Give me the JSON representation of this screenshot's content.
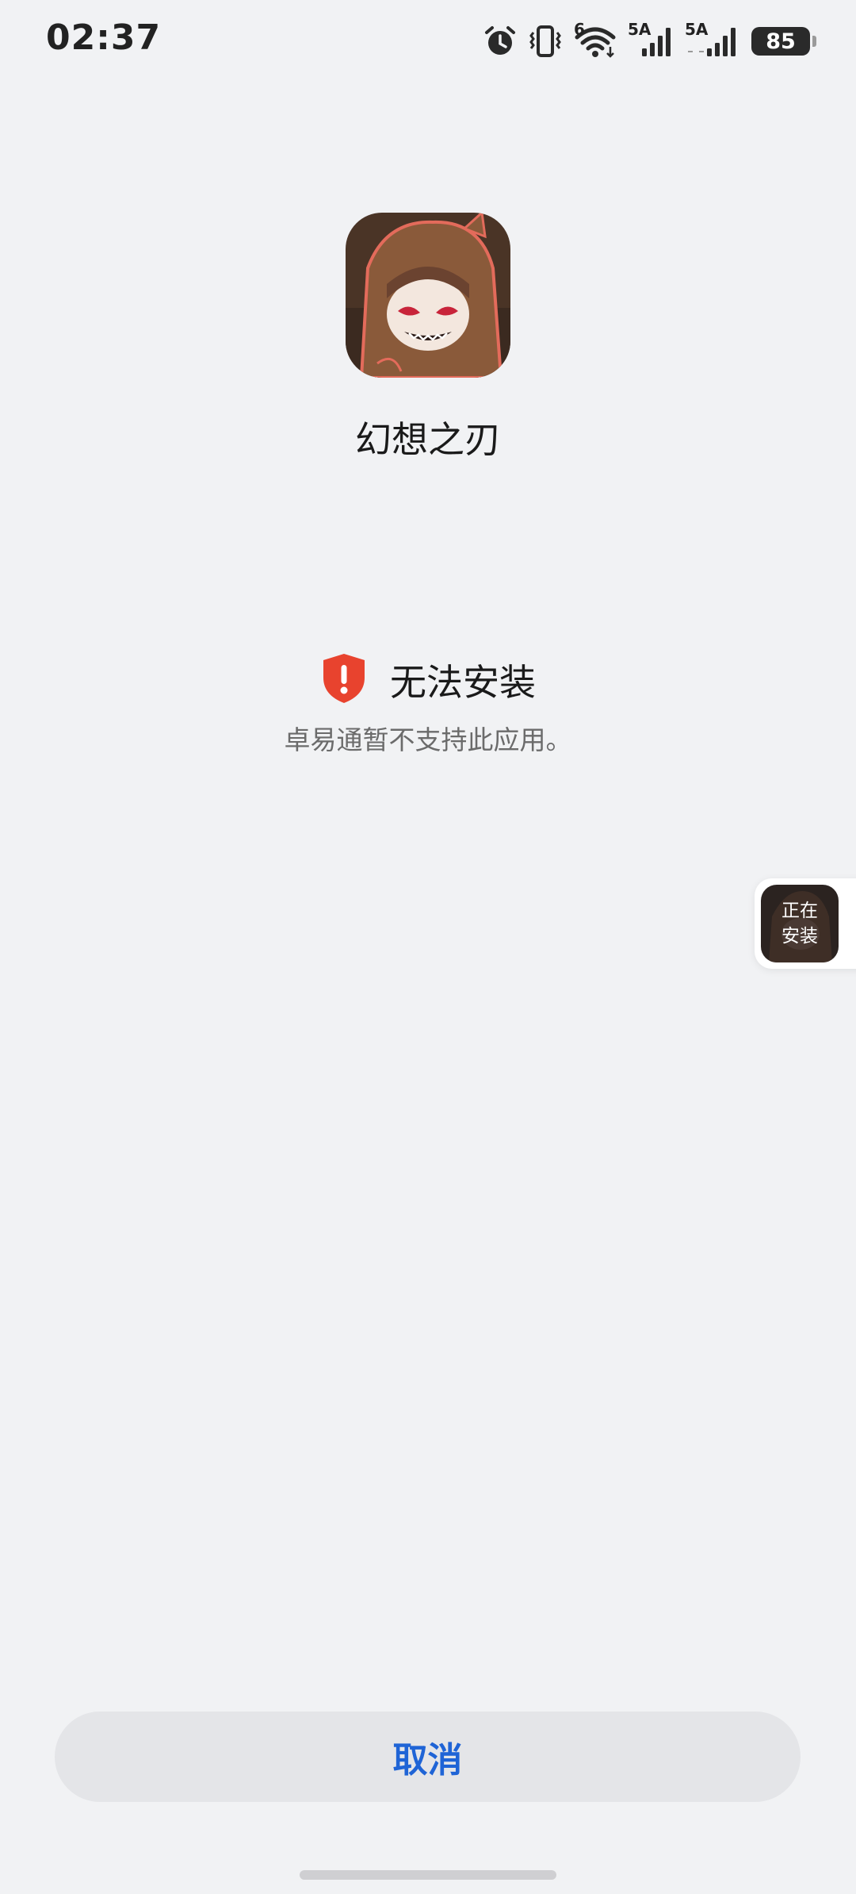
{
  "status_bar": {
    "time": "02:37",
    "wifi_badge": "6",
    "sim1_tag": "5A",
    "sim2_tag": "5A",
    "battery": "85",
    "icons": [
      "alarm-icon",
      "vibrate-icon",
      "wifi-icon",
      "signal-sim1-icon",
      "signal-sim2-icon",
      "battery-icon"
    ]
  },
  "app": {
    "name": "幻想之刃",
    "icon": "app-icon-hooded-character"
  },
  "error": {
    "icon": "shield-alert-icon",
    "title": "无法安装",
    "description": "卓易通暂不支持此应用。",
    "color": "#e8432e"
  },
  "installing_badge": {
    "label": "正在\n安装"
  },
  "actions": {
    "cancel_label": "取消",
    "cancel_color": "#1f64d6"
  }
}
